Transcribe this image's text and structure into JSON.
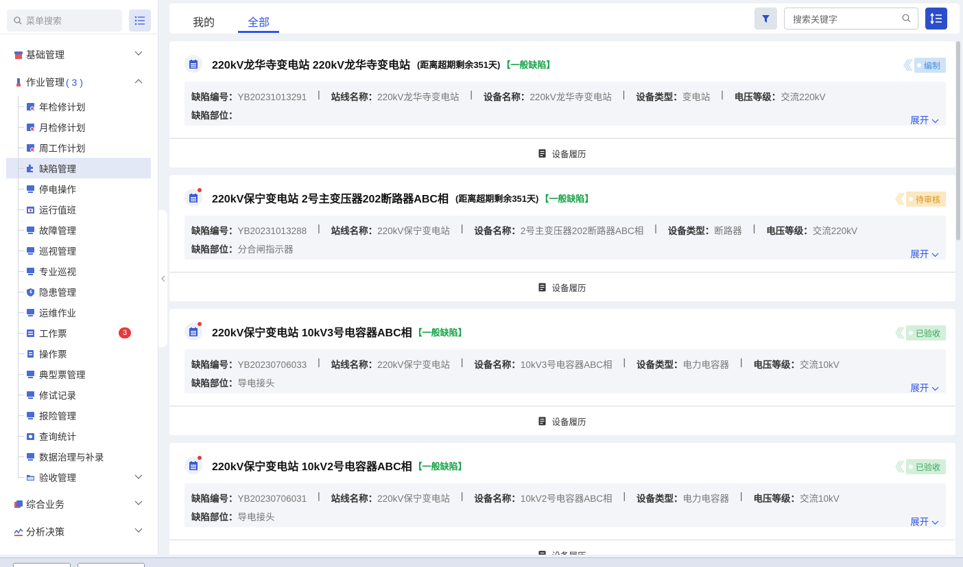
{
  "sidebar": {
    "search_placeholder": "菜单搜索",
    "groups": [
      {
        "label": "基础管理"
      },
      {
        "label": "作业管理",
        "count": "( 3 )"
      },
      {
        "label": "综合业务"
      },
      {
        "label": "分析决策"
      }
    ],
    "items": [
      {
        "label": "年检修计划"
      },
      {
        "label": "月检修计划"
      },
      {
        "label": "周工作计划"
      },
      {
        "label": "缺陷管理"
      },
      {
        "label": "停电操作"
      },
      {
        "label": "运行值班"
      },
      {
        "label": "故障管理"
      },
      {
        "label": "巡视管理"
      },
      {
        "label": "专业巡视"
      },
      {
        "label": "隐患管理"
      },
      {
        "label": "运维作业"
      },
      {
        "label": "工作票",
        "badge": "3"
      },
      {
        "label": "操作票"
      },
      {
        "label": "典型票管理"
      },
      {
        "label": "修试记录"
      },
      {
        "label": "报险管理"
      },
      {
        "label": "查询统计"
      },
      {
        "label": "数据治理与补录"
      },
      {
        "label": "验收管理"
      }
    ]
  },
  "topbar": {
    "tabs": [
      {
        "label": "我的"
      },
      {
        "label": "全部"
      }
    ],
    "active_tab": "全部",
    "search_placeholder": "搜索关键字"
  },
  "labels": {
    "defect_no": "缺陷编号：",
    "station": "站线名称：",
    "device": "设备名称：",
    "device_type": "设备类型：",
    "voltage": "电压等级：",
    "part": "缺陷部位：",
    "expand": "展开",
    "history": "设备履历",
    "sep": "|"
  },
  "cards": [
    {
      "title": "220kV龙华寺变电站 220kV龙华寺变电站",
      "days": "(距离超期剩余351天)",
      "level": "【一般缺陷】",
      "status": "编制",
      "status_color": "#4a90d9",
      "status_bg": "#cfe3f7",
      "defect_no": "YB20231013291",
      "station": "220kV龙华寺变电站",
      "device": "220kV龙华寺变电站",
      "device_type": "变电站",
      "voltage": "交流220kV",
      "part": "",
      "unread": false
    },
    {
      "title": "220kV保宁变电站 2号主变压器202断路器ABC相",
      "days": "(距离超期剩余351天)",
      "level": "【一般缺陷】",
      "status": "待审核",
      "status_color": "#d9961a",
      "status_bg": "#fbe7c1",
      "defect_no": "YB20231013288",
      "station": "220kV保宁变电站",
      "device": "2号主变压器202断路器ABC相",
      "device_type": "断路器",
      "voltage": "交流220kV",
      "part": "分合闸指示器",
      "unread": true
    },
    {
      "title": "220kV保宁变电站 10kV3号电容器ABC相",
      "days": "",
      "level": "【一般缺陷】",
      "status": "已验收",
      "status_color": "#3aa55c",
      "status_bg": "#d3efd9",
      "defect_no": "YB20230706033",
      "station": "220kV保宁变电站",
      "device": "10kV3号电容器ABC相",
      "device_type": "电力电容器",
      "voltage": "交流10kV",
      "part": "导电接头",
      "unread": true
    },
    {
      "title": "220kV保宁变电站 10kV2号电容器ABC相",
      "days": "",
      "level": "【一般缺陷】",
      "status": "已验收",
      "status_color": "#3aa55c",
      "status_bg": "#d3efd9",
      "defect_no": "YB20230706031",
      "station": "220kV保宁变电站",
      "device": "10kV2号电容器ABC相",
      "device_type": "电力电容器",
      "voltage": "交流10kV",
      "part": "导电接头",
      "unread": true
    }
  ],
  "colors": {
    "accent": "#2f54eb",
    "level": "#1aa34a",
    "badge": "#e8383d"
  }
}
